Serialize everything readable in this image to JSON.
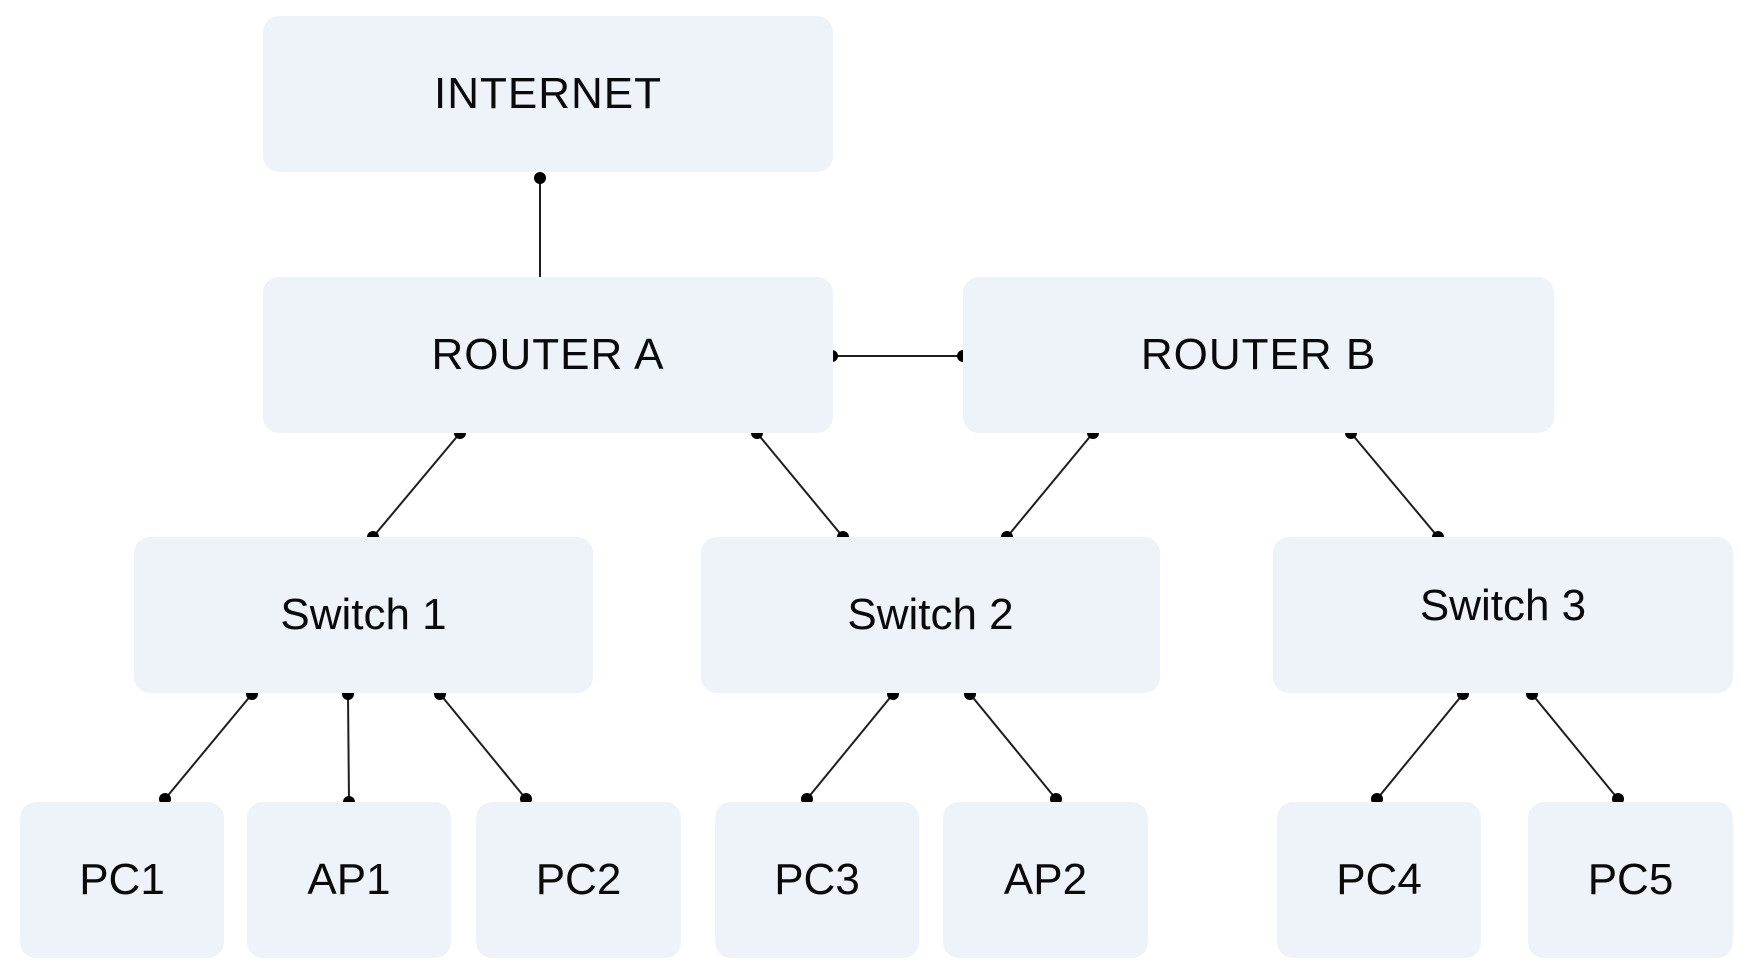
{
  "diagram": {
    "type": "network-topology",
    "colors": {
      "node_fill": "#eef2f9",
      "link": "#1e1e1e",
      "endpoint": "#000000",
      "text": "#0a0a0a"
    },
    "nodes": {
      "internet": {
        "label": "INTERNET",
        "kind": "internet"
      },
      "router_a": {
        "label": "ROUTER A",
        "kind": "router"
      },
      "router_b": {
        "label": "ROUTER B",
        "kind": "router"
      },
      "switch_1": {
        "label": "Switch 1",
        "kind": "switch"
      },
      "switch_2": {
        "label": "Switch 2",
        "kind": "switch"
      },
      "switch_3": {
        "label": "Switch 3",
        "kind": "switch"
      },
      "pc1": {
        "label": "PC1",
        "kind": "pc"
      },
      "ap1": {
        "label": "AP1",
        "kind": "access-point"
      },
      "pc2": {
        "label": "PC2",
        "kind": "pc"
      },
      "pc3": {
        "label": "PC3",
        "kind": "pc"
      },
      "ap2": {
        "label": "AP2",
        "kind": "access-point"
      },
      "pc4": {
        "label": "PC4",
        "kind": "pc"
      },
      "pc5": {
        "label": "PC5",
        "kind": "pc"
      }
    },
    "links": [
      {
        "from": "internet",
        "to": "router_a"
      },
      {
        "from": "router_a",
        "to": "router_b"
      },
      {
        "from": "router_a",
        "to": "switch_1"
      },
      {
        "from": "router_a",
        "to": "switch_2"
      },
      {
        "from": "router_b",
        "to": "switch_2"
      },
      {
        "from": "router_b",
        "to": "switch_3"
      },
      {
        "from": "switch_1",
        "to": "pc1"
      },
      {
        "from": "switch_1",
        "to": "ap1"
      },
      {
        "from": "switch_1",
        "to": "pc2"
      },
      {
        "from": "switch_2",
        "to": "pc3"
      },
      {
        "from": "switch_2",
        "to": "ap2"
      },
      {
        "from": "switch_3",
        "to": "pc4"
      },
      {
        "from": "switch_3",
        "to": "pc5"
      }
    ]
  }
}
